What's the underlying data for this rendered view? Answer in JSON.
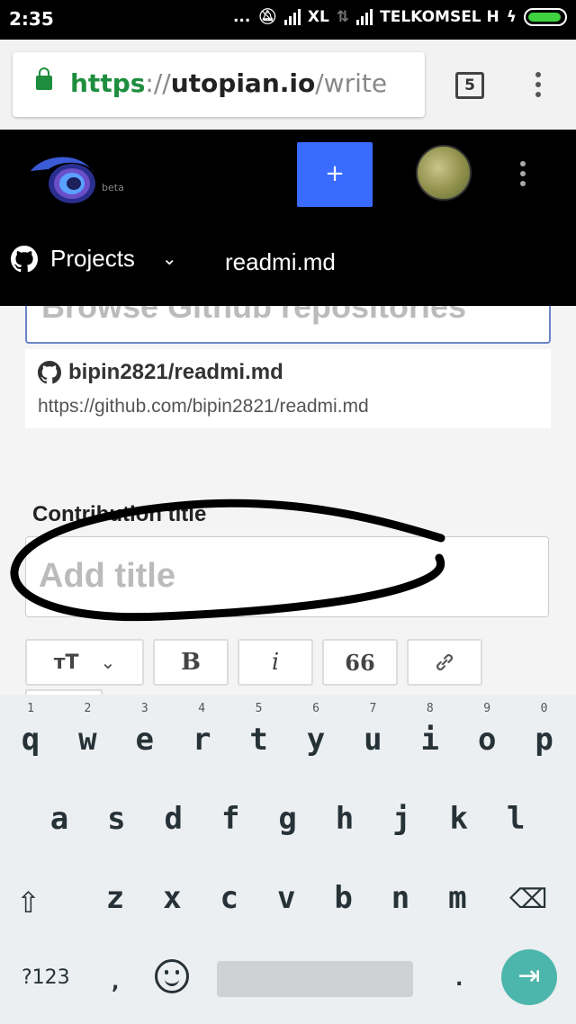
{
  "status_bar": {
    "time": "2:35",
    "dots": "...",
    "carrier1": "XL",
    "carrier2": "TELKOMSEL H"
  },
  "browser": {
    "url_scheme": "https",
    "url_sep": "://",
    "url_host": "utopian.io",
    "url_path": "/write",
    "tab_count": "5",
    "secure_icon": "lock-icon"
  },
  "app_header": {
    "beta_label": "beta",
    "new_button": "+",
    "projects_label": "Projects",
    "repo_tab": "readmi.md"
  },
  "search": {
    "placeholder": "Browse Github repositories"
  },
  "result": {
    "repo_name": "bipin2821/readmi.md",
    "repo_url": "https://github.com/bipin2821/readmi.md"
  },
  "title_field": {
    "label": "Contribution title",
    "placeholder": "Add title"
  },
  "editor_toolbar": {
    "heading": "тТ",
    "bold": "B",
    "italic": "i",
    "quote": "66",
    "link_icon": "link-icon"
  },
  "keyboard": {
    "row1": [
      "q",
      "w",
      "e",
      "r",
      "t",
      "y",
      "u",
      "i",
      "o",
      "p"
    ],
    "row1_hints": [
      "1",
      "2",
      "3",
      "4",
      "5",
      "6",
      "7",
      "8",
      "9",
      "0"
    ],
    "row2": [
      "a",
      "s",
      "d",
      "f",
      "g",
      "h",
      "j",
      "k",
      "l"
    ],
    "row3": [
      "z",
      "x",
      "c",
      "v",
      "b",
      "n",
      "m"
    ],
    "symbols": "?123",
    "comma": ",",
    "period": "."
  },
  "colors": {
    "secure_green": "#1e8e3e",
    "brand_blue": "#3a6bff",
    "enter_teal": "#4db6ac"
  }
}
